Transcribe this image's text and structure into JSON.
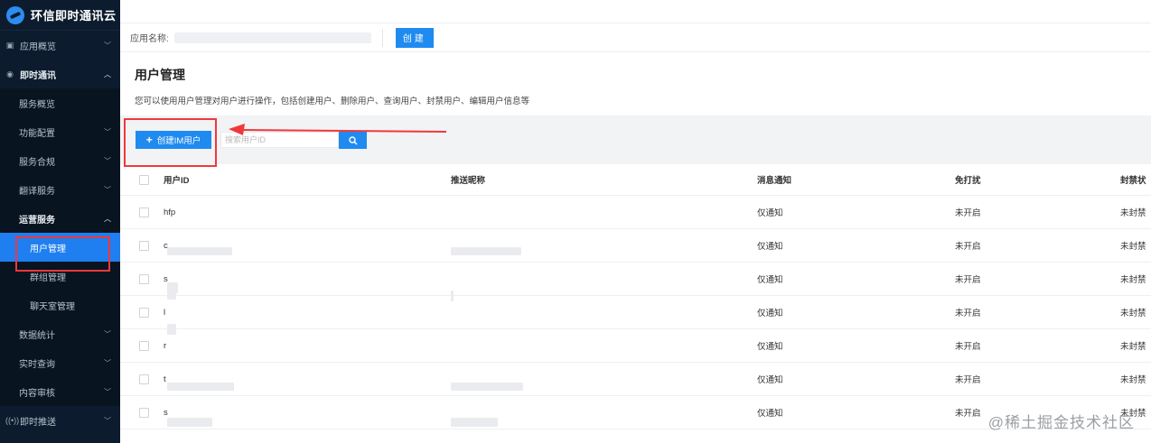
{
  "sidebar": {
    "brand": "环信即时通讯云",
    "items": [
      {
        "label": "应用概览",
        "icon": "grid-icon"
      },
      {
        "label": "即时通讯",
        "icon": "chat-icon"
      },
      {
        "label": "服务概览"
      },
      {
        "label": "功能配置"
      },
      {
        "label": "服务合规"
      },
      {
        "label": "翻译服务"
      },
      {
        "label": "运营服务"
      },
      {
        "label": "用户管理"
      },
      {
        "label": "群组管理"
      },
      {
        "label": "聊天室管理"
      },
      {
        "label": "数据统计"
      },
      {
        "label": "实时查询"
      },
      {
        "label": "内容审核"
      },
      {
        "label": "即时推送",
        "icon": "broadcast-icon"
      }
    ]
  },
  "appbar": {
    "app_name_label": "应用名称:",
    "create_label": "创建"
  },
  "page": {
    "title": "用户管理",
    "description": "您可以使用用户管理对用户进行操作，包括创建用户、删除用户、查询用户、封禁用户、编辑用户信息等"
  },
  "toolbar": {
    "add_button": "创建IM用户",
    "search_placeholder": "搜索用户ID"
  },
  "table": {
    "headers": [
      "用户ID",
      "推送昵称",
      "消息通知",
      "免打扰",
      "封禁状"
    ],
    "rows": [
      {
        "id": "hfp",
        "notify": "仅通知",
        "dnd": "未开启",
        "ban": "未封禁"
      },
      {
        "id": "c",
        "notify": "仅通知",
        "dnd": "未开启",
        "ban": "未封禁"
      },
      {
        "id": "s",
        "notify": "仅通知",
        "dnd": "未开启",
        "ban": "未封禁"
      },
      {
        "id": "l",
        "notify": "仅通知",
        "dnd": "未开启",
        "ban": "未封禁"
      },
      {
        "id": "r",
        "notify": "仅通知",
        "dnd": "未开启",
        "ban": "未封禁"
      },
      {
        "id": "t",
        "notify": "仅通知",
        "dnd": "未开启",
        "ban": "未封禁"
      },
      {
        "id": "s",
        "notify": "仅通知",
        "dnd": "未开启",
        "ban": "未封禁"
      }
    ]
  },
  "watermark": "@稀土掘金技术社区",
  "colors": {
    "sidebar_bg": "#0c1c2e",
    "accent": "#1f8bf0",
    "highlight": "#f0383c"
  }
}
